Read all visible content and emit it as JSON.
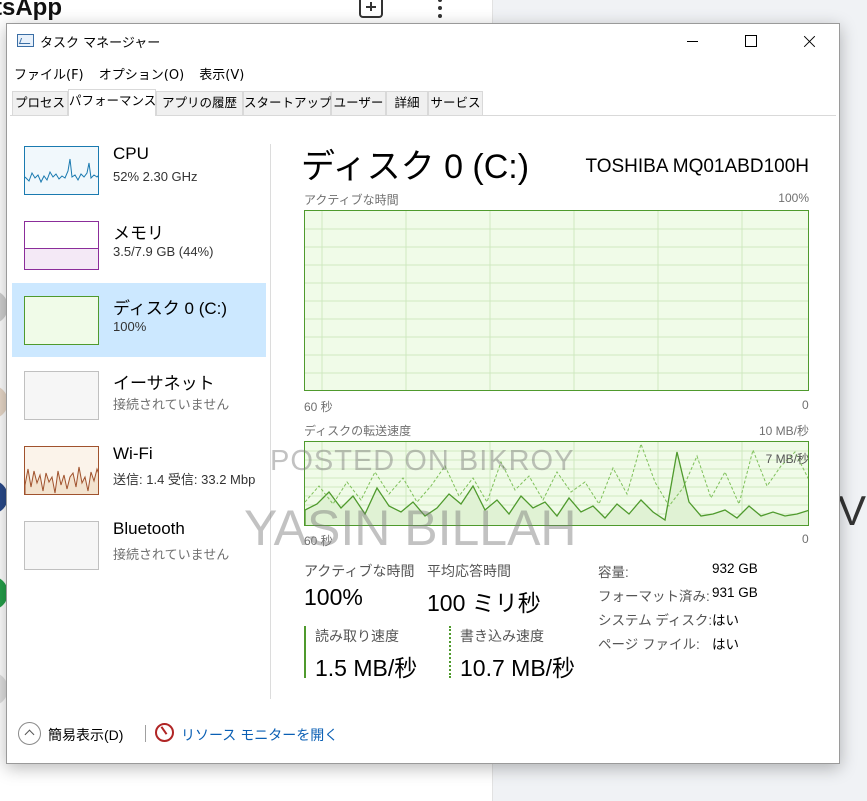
{
  "background": {
    "app_title": "tsApp",
    "right_text": "V"
  },
  "window": {
    "title": "タスク マネージャー"
  },
  "menu": [
    "ファイル(F)",
    "オプション(O)",
    "表示(V)"
  ],
  "tabs": [
    "プロセス",
    "パフォーマンス",
    "アプリの履歴",
    "スタートアップ",
    "ユーザー",
    "詳細",
    "サービス"
  ],
  "active_tab": "パフォーマンス",
  "sidebar": {
    "items": [
      {
        "name": "CPU",
        "sub": "52% 2.30 GHz",
        "utilization_percent": 52
      },
      {
        "name": "メモリ",
        "sub": "3.5/7.9 GB (44%)",
        "utilization_percent": 44
      },
      {
        "name": "ディスク 0 (C:)",
        "sub": "100%",
        "utilization_percent": 100,
        "selected": true
      },
      {
        "name": "イーサネット",
        "sub": "接続されていません"
      },
      {
        "name": "Wi-Fi",
        "sub": "送信: 1.4 受信: 33.2 Mbp"
      },
      {
        "name": "Bluetooth",
        "sub": "接続されていません"
      }
    ]
  },
  "detail": {
    "title": "ディスク 0 (C:)",
    "model": "TOSHIBA MQ01ABD100H",
    "active_graph": {
      "label": "アクティブな時間",
      "max_label": "100%",
      "time_label": "60 秒",
      "min_label": "0",
      "value_percent": 100
    },
    "transfer_graph": {
      "label": "ディスクの転送速度",
      "max_label": "10 MB/秒",
      "inner_label": "7 MB/秒",
      "time_label": "60 秒",
      "min_label": "0"
    },
    "stats": {
      "active_time_label": "アクティブな時間",
      "active_time_value": "100%",
      "response_label": "平均応答時間",
      "response_value": "100 ミリ秒",
      "read_label": "読み取り速度",
      "read_value": "1.5 MB/秒",
      "write_label": "書き込み速度",
      "write_value": "10.7 MB/秒"
    },
    "properties": [
      {
        "key": "容量:",
        "value": "932 GB"
      },
      {
        "key": "フォーマット済み:",
        "value": "931 GB"
      },
      {
        "key": "システム ディスク:",
        "value": "はい"
      },
      {
        "key": "ページ ファイル:",
        "value": "はい"
      }
    ]
  },
  "footer": {
    "fewer_details": "簡易表示(D)",
    "resource_monitor": "リソース モニターを開く"
  },
  "watermark": {
    "line1": "POSTED ON BIKROY",
    "line2": "YASIN BILLAH"
  },
  "colors": {
    "disk_line": "#4f9a2d",
    "disk_fill": "#f0fbe8",
    "cpu_line": "#1a7ab0",
    "memory_line": "#8b2d9a",
    "wifi_line": "#a0522d",
    "selected_bg": "#cce8ff",
    "link": "#0a5fb4"
  }
}
